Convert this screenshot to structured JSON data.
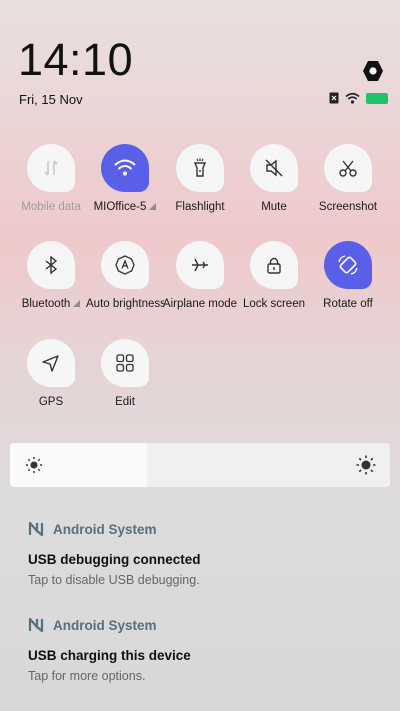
{
  "status": {
    "time": "14:10",
    "date": "Fri, 15 Nov",
    "icons": [
      "sim-off-icon",
      "wifi-icon",
      "battery-icon"
    ],
    "battery_color": "#1fc46a",
    "settings_icon": "gear-icon"
  },
  "tiles": [
    {
      "label": "Mobile data",
      "icon": "mobile-data-icon",
      "active": false,
      "dim": true
    },
    {
      "label": "MIOffice-5",
      "icon": "wifi-icon",
      "active": true,
      "dropdown": true
    },
    {
      "label": "Flashlight",
      "icon": "flashlight-icon",
      "active": false
    },
    {
      "label": "Mute",
      "icon": "mute-icon",
      "active": false
    },
    {
      "label": "Screenshot",
      "icon": "scissors-icon",
      "active": false
    },
    {
      "label": "Bluetooth",
      "icon": "bluetooth-icon",
      "active": false,
      "dropdown": true
    },
    {
      "label": "Auto brightness",
      "icon": "auto-brightness-icon",
      "active": false
    },
    {
      "label": "Airplane mode",
      "icon": "airplane-icon",
      "active": false
    },
    {
      "label": "Lock screen",
      "icon": "lock-icon",
      "active": false
    },
    {
      "label": "Rotate off",
      "icon": "rotate-icon",
      "active": true
    },
    {
      "label": "GPS",
      "icon": "location-icon",
      "active": false
    },
    {
      "label": "Edit",
      "icon": "grid-icon",
      "active": false
    }
  ],
  "brightness": {
    "level": 0.36,
    "low_icon": "sun-small-icon",
    "high_icon": "sun-large-icon"
  },
  "notifications": [
    {
      "app": "Android System",
      "title": "USB debugging connected",
      "text": "Tap to disable USB debugging."
    },
    {
      "app": "Android System",
      "title": "USB charging this device",
      "text": "Tap for more options."
    }
  ],
  "colors": {
    "accent": "#5a5fe8",
    "notif_app": "#56717b"
  }
}
